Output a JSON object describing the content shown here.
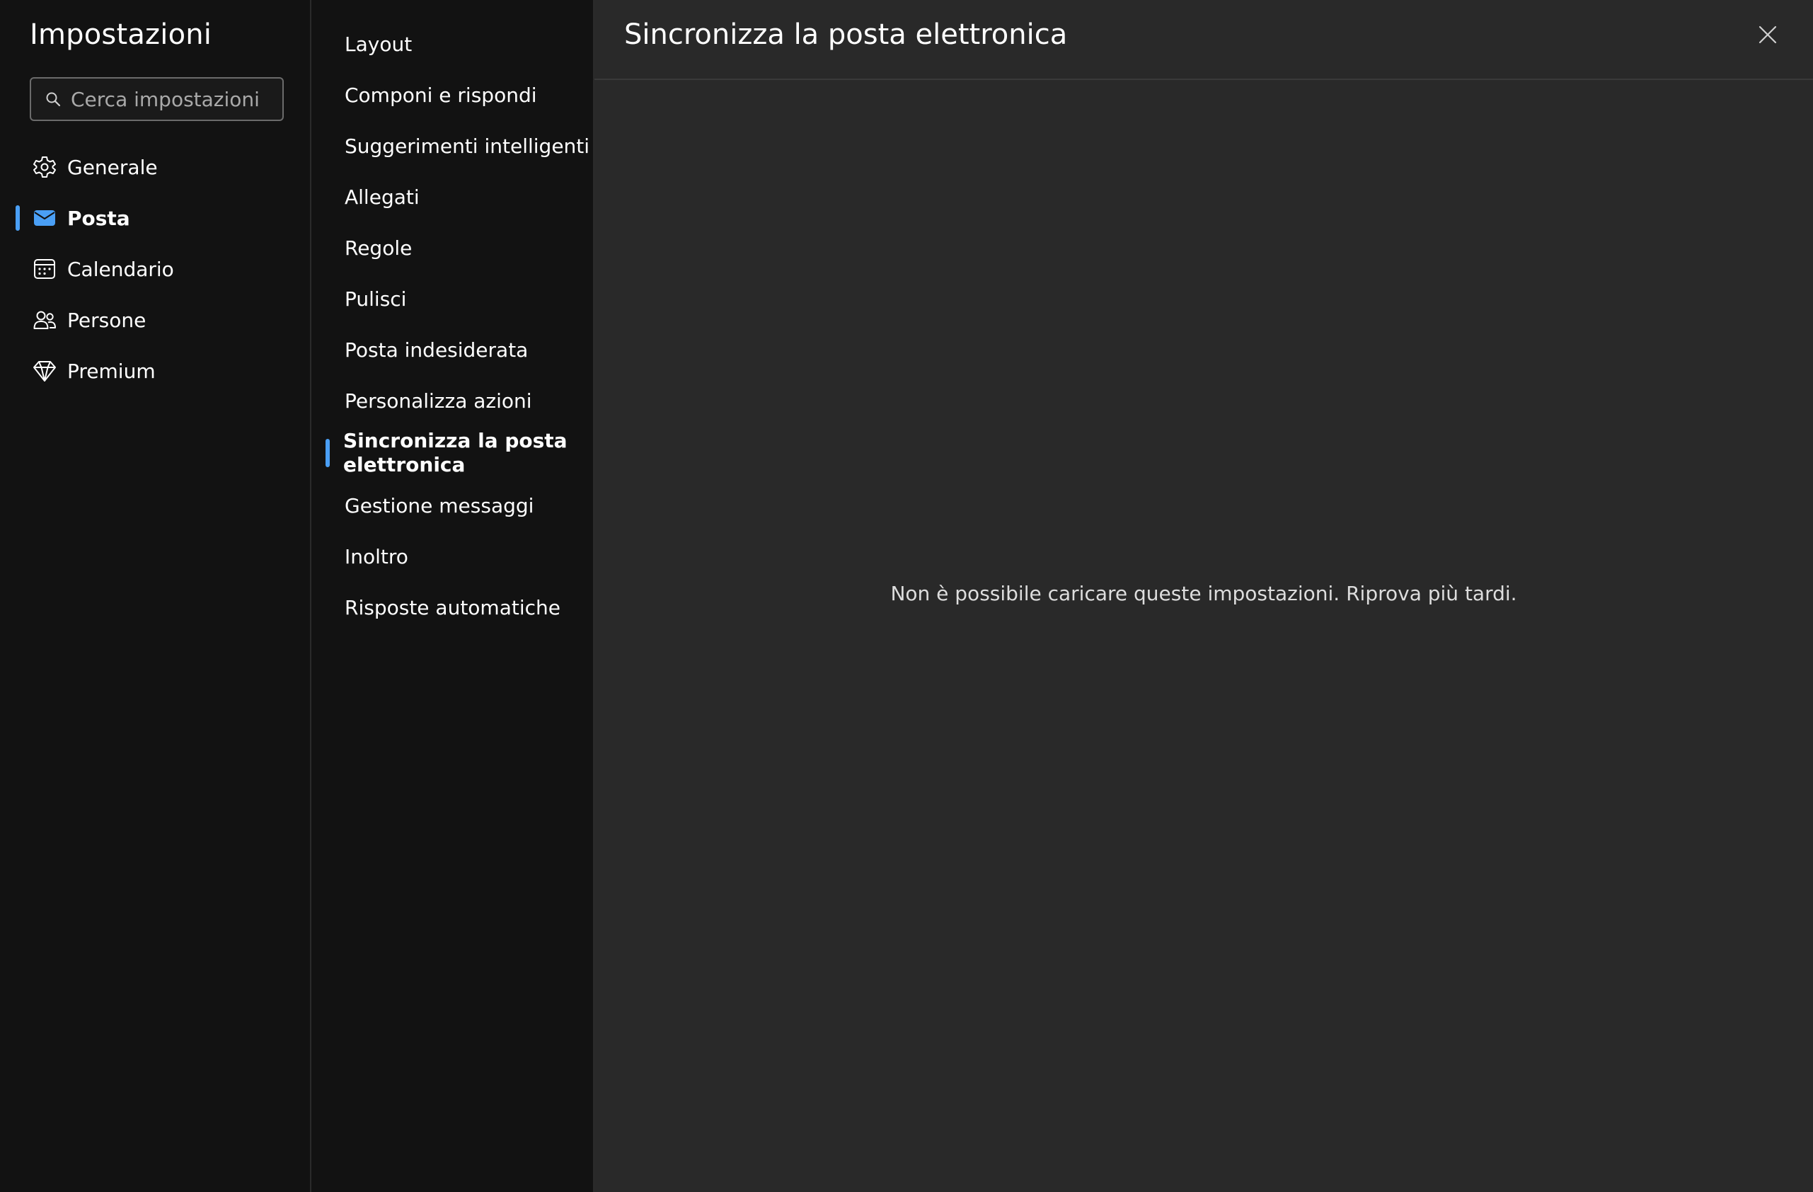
{
  "sidebar": {
    "title": "Impostazioni",
    "search": {
      "placeholder": "Cerca impostazioni",
      "value": ""
    },
    "items": [
      {
        "label": "Generale",
        "icon": "gear-icon",
        "active": false
      },
      {
        "label": "Posta",
        "icon": "mail-icon",
        "active": true
      },
      {
        "label": "Calendario",
        "icon": "calendar-icon",
        "active": false
      },
      {
        "label": "Persone",
        "icon": "people-icon",
        "active": false
      },
      {
        "label": "Premium",
        "icon": "diamond-icon",
        "active": false
      }
    ]
  },
  "subnav": {
    "items": [
      {
        "label": "Layout",
        "active": false
      },
      {
        "label": "Componi e rispondi",
        "active": false
      },
      {
        "label": "Suggerimenti intelligenti",
        "active": false
      },
      {
        "label": "Allegati",
        "active": false
      },
      {
        "label": "Regole",
        "active": false
      },
      {
        "label": "Pulisci",
        "active": false
      },
      {
        "label": "Posta indesiderata",
        "active": false
      },
      {
        "label": "Personalizza azioni",
        "active": false
      },
      {
        "label": "Sincronizza la posta elettronica",
        "active": true
      },
      {
        "label": "Gestione messaggi",
        "active": false
      },
      {
        "label": "Inoltro",
        "active": false
      },
      {
        "label": "Risposte automatiche",
        "active": false
      }
    ]
  },
  "main": {
    "title": "Sincronizza la posta elettronica",
    "error_message": "Non è possibile caricare queste impostazioni. Riprova più tardi."
  },
  "colors": {
    "accent": "#4a9ff5",
    "background_main": "#292929",
    "background_sidebar": "#121212"
  }
}
